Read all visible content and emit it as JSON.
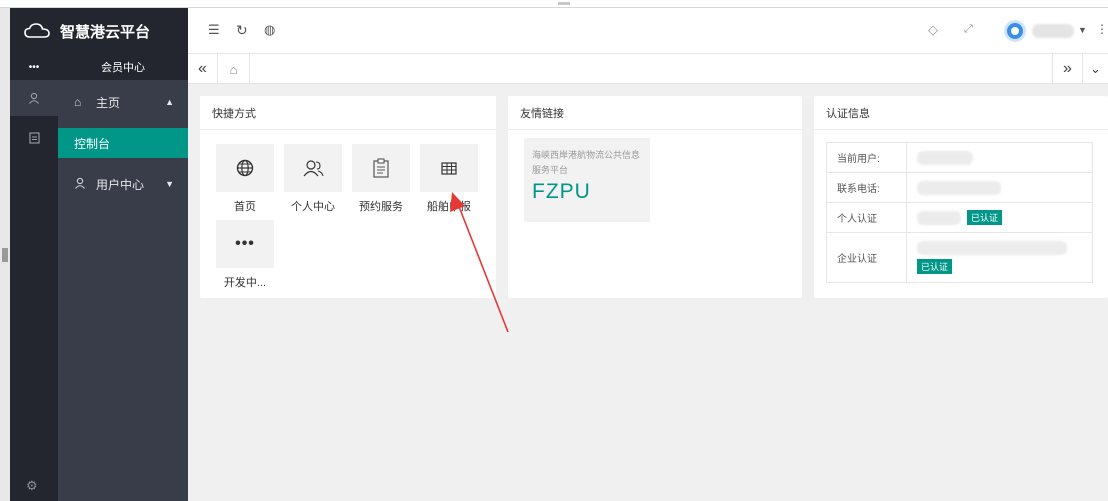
{
  "app": {
    "title": "智慧港云平台"
  },
  "sidebar": {
    "member_center": "会员中心",
    "items": [
      {
        "label": "主页",
        "icon": "home-icon"
      },
      {
        "label": "控制台",
        "active": true
      },
      {
        "label": "用户中心",
        "icon": "user-icon"
      }
    ]
  },
  "shortcuts": {
    "title": "快捷方式",
    "items": [
      {
        "label": "首页",
        "icon": "globe-icon"
      },
      {
        "label": "个人中心",
        "icon": "users-icon"
      },
      {
        "label": "预约服务",
        "icon": "clipboard-icon"
      },
      {
        "label": "船舶申报",
        "icon": "grid-icon"
      },
      {
        "label": "开发中...",
        "icon": "more-icon"
      }
    ]
  },
  "links": {
    "title": "友情链接",
    "item_desc": "海峡西岸港航物流公共信息服务平台",
    "item_code": "FZPU"
  },
  "cert": {
    "title": "认证信息",
    "rows": [
      {
        "key": "当前用户:"
      },
      {
        "key": "联系电话:"
      },
      {
        "key": "个人认证",
        "badge": "已认证"
      },
      {
        "key": "企业认证",
        "badge": "已认证"
      }
    ]
  },
  "theme": {
    "sidebar_dark": "#23262e",
    "sidebar_mid": "#393d49",
    "accent": "#009688"
  }
}
